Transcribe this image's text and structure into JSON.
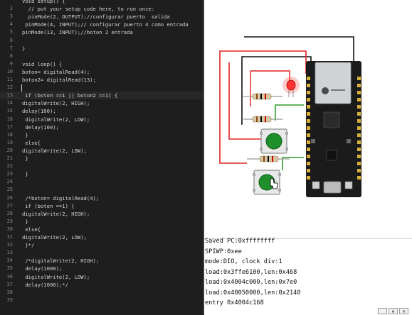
{
  "editor": {
    "lines": [
      {
        "n": "",
        "text": "void setup() {"
      },
      {
        "n": "2",
        "text": "  // put your setup code here, to run once:"
      },
      {
        "n": "3",
        "text": "  pinMode(2, OUTPUT);//configurar puerto  salida"
      },
      {
        "n": "4",
        "text": " pinMode(4, INPUT);// configurar puerto 4 como entrada"
      },
      {
        "n": "5",
        "text": "pinMode(13, INPUT);//boton 2 entrada"
      },
      {
        "n": "6",
        "text": ""
      },
      {
        "n": "7",
        "text": "}"
      },
      {
        "n": "8",
        "text": ""
      },
      {
        "n": "9",
        "text": "void loop() {"
      },
      {
        "n": "10",
        "text": "boton= digitalRead(4);"
      },
      {
        "n": "11",
        "text": "boton2= digitalRead(13);"
      },
      {
        "n": "12",
        "text": ""
      },
      {
        "n": "13",
        "text": " if (boton ==1 || boton2 ==1) {"
      },
      {
        "n": "14",
        "text": "digitalWrite(2, HIGH);"
      },
      {
        "n": "15",
        "text": "delay(100);"
      },
      {
        "n": "16",
        "text": " digitalWrite(2, LOW);"
      },
      {
        "n": "17",
        "text": " delay(100);"
      },
      {
        "n": "18",
        "text": " }"
      },
      {
        "n": "19",
        "text": " else{"
      },
      {
        "n": "20",
        "text": "digitalWrite(2, LOW);"
      },
      {
        "n": "21",
        "text": " }"
      },
      {
        "n": "22",
        "text": ""
      },
      {
        "n": "23",
        "text": " }"
      },
      {
        "n": "24",
        "text": ""
      },
      {
        "n": "25",
        "text": ""
      },
      {
        "n": "26",
        "text": " /*boton= digitalRead(4);"
      },
      {
        "n": "27",
        "text": " if (boton ==1) {"
      },
      {
        "n": "28",
        "text": "digitalWrite(2, HIGH);"
      },
      {
        "n": "29",
        "text": " }"
      },
      {
        "n": "30",
        "text": " else{"
      },
      {
        "n": "31",
        "text": "digitalWrite(2, LOW);"
      },
      {
        "n": "32",
        "text": " }*/"
      },
      {
        "n": "33",
        "text": ""
      },
      {
        "n": "34",
        "text": " /*digitalWrite(2, HIGH);"
      },
      {
        "n": "35",
        "text": " delay(1000);"
      },
      {
        "n": "36",
        "text": " digitalWrite(2, LOW);"
      },
      {
        "n": "37",
        "text": " delay(1000);*/"
      },
      {
        "n": "38",
        "text": ""
      },
      {
        "n": "39",
        "text": ""
      }
    ],
    "current_line": 12
  },
  "serial": {
    "lines": [
      "Saved PC:0xffffffff",
      "SPIWP:0xee",
      "mode:DIO, clock div:1",
      "load:0x3ffe6100,len:0x468",
      "load:0x4004c000,len:0x7e0",
      "load:0x40050000,len:0x2140",
      "entry 0x4004c168"
    ]
  },
  "colors": {
    "editor_bg": "#1e1e1e",
    "wire_red": "#e02020",
    "wire_black": "#111111",
    "wire_green": "#2e9e2e",
    "board_black": "#1b1b1b",
    "pin_gold": "#d8b13a",
    "button_green": "#1e8f2a",
    "led_red": "#ff3333"
  }
}
